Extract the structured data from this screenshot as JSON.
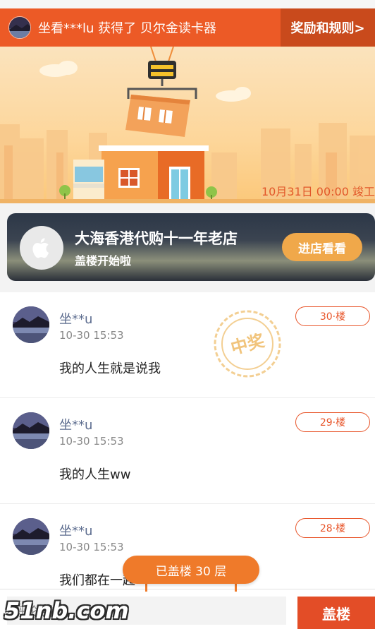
{
  "notice": {
    "text": "坐看***lu 获得了 贝尔金读卡器",
    "rules_link": "奖励和规则>"
  },
  "banner": {
    "deadline": "10月31日 00:00 竣工"
  },
  "shop": {
    "logo_icon": "apple-icon",
    "name": "大海香港代购十一年老店",
    "subtitle": "盖楼开始啦",
    "visit_button": "进店看看"
  },
  "posts": [
    {
      "user": "坐**u",
      "time": "10-30 15:53",
      "message": "我的人生就是说我",
      "floor": "30·楼",
      "winner_stamp": "中奖"
    },
    {
      "user": "坐**u",
      "time": "10-30 15:53",
      "message": "我的人生ww",
      "floor": "29·楼"
    },
    {
      "user": "坐**u",
      "time": "10-30 15:53",
      "message": "我们都在一起",
      "floor": "28·楼"
    }
  ],
  "built_counter": "已盖楼 30 层",
  "composer": {
    "placeholder": "评论盖楼",
    "submit_button": "盖楼"
  },
  "watermark": "51nb.com",
  "colors": {
    "accent": "#ec5a26",
    "rules_bg": "#c94a1c",
    "floor_border": "#e8552a",
    "visit_button": "#f0a84a",
    "submit_button": "#e34d27"
  }
}
